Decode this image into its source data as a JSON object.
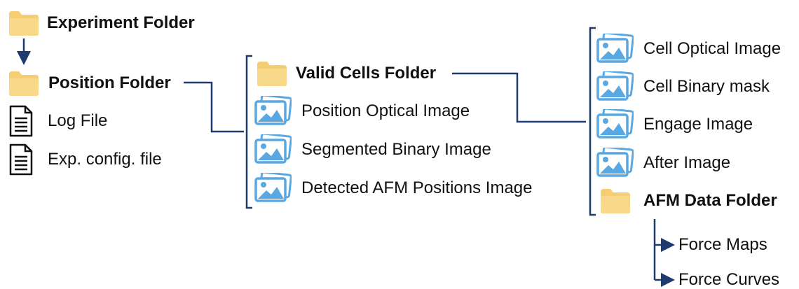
{
  "tree": {
    "experiment_folder": "Experiment Folder",
    "position_folder": "Position Folder",
    "log_file": "Log File",
    "exp_config_file": "Exp. config. file",
    "valid_cells_folder": "Valid Cells Folder",
    "position_optical_image": "Position Optical Image",
    "segmented_binary_image": "Segmented Binary Image",
    "detected_afm_positions_image": "Detected AFM Positions Image",
    "cell_optical_image": "Cell Optical Image",
    "cell_binary_mask": "Cell Binary mask",
    "engage_image": "Engage Image",
    "after_image": "After Image",
    "afm_data_folder": "AFM Data Folder",
    "force_maps": "Force Maps",
    "force_curves": "Force Curves"
  },
  "colors": {
    "connector": "#1f3a6e",
    "folder": "#f5cd73",
    "image_icon": "#5aa8e2"
  },
  "icons": {
    "folder": "folder-icon",
    "file": "document-icon",
    "image": "image-icon"
  }
}
